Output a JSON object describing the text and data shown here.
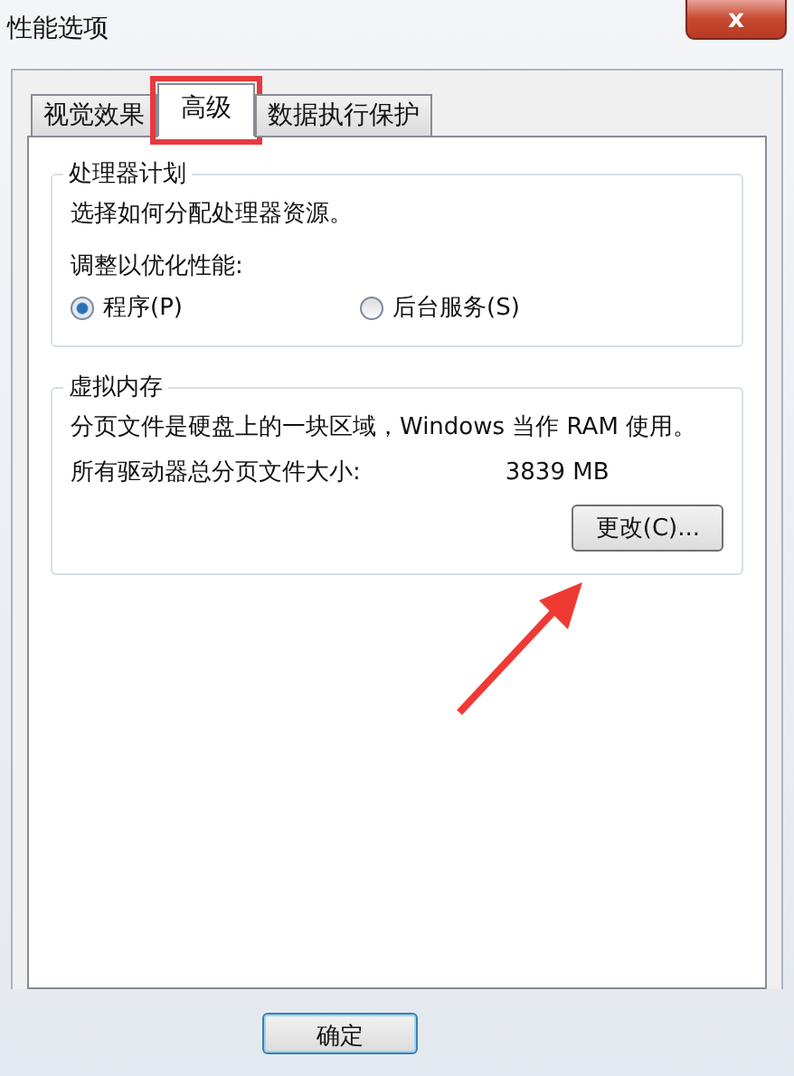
{
  "window": {
    "title": "性能选项",
    "close": "x"
  },
  "tabs": [
    {
      "label": "视觉效果",
      "selected": false,
      "highlighted": false
    },
    {
      "label": "高级",
      "selected": true,
      "highlighted": true
    },
    {
      "label": "数据执行保护",
      "selected": false,
      "highlighted": false
    }
  ],
  "processor_group": {
    "title": "处理器计划",
    "description": "选择如何分配处理器资源。",
    "prompt": "调整以优化性能:",
    "options": [
      {
        "label": "程序(P)",
        "selected": true
      },
      {
        "label": "后台服务(S)",
        "selected": false
      }
    ]
  },
  "memory_group": {
    "title": "虚拟内存",
    "description": "分页文件是硬盘上的一块区域，Windows 当作 RAM 使用。",
    "total_label": "所有驱动器总分页文件大小:",
    "total_value": "3839 MB",
    "button": "更改(C)..."
  },
  "footer": {
    "buttons": [
      "确定"
    ]
  }
}
